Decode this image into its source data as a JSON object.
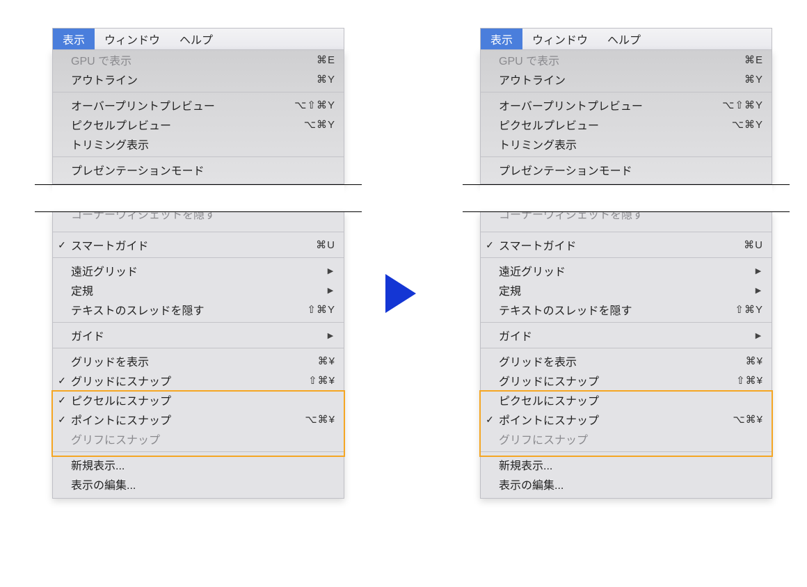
{
  "menubar": {
    "view": "表示",
    "window": "ウィンドウ",
    "help": "ヘルプ"
  },
  "top_group": {
    "gpu_preview": "GPU で表示",
    "gpu_preview_sc": "⌘E",
    "outline": "アウトライン",
    "outline_sc": "⌘Y",
    "overprint": "オーバープリントプレビュー",
    "overprint_sc": "⌥⇧⌘Y",
    "pixel_preview": "ピクセルプレビュー",
    "pixel_preview_sc": "⌥⌘Y",
    "trim_view": "トリミング表示",
    "presentation": "プレゼンテーションモード"
  },
  "cut": {
    "corner_widget": "コーナーウィジェットを隠す"
  },
  "mid_group": {
    "smart_guides": "スマートガイド",
    "smart_guides_sc": "⌘U",
    "perspective_grid": "遠近グリッド",
    "rulers": "定規",
    "hide_text_threads": "テキストのスレッドを隠す",
    "hide_text_threads_sc": "⇧⌘Y",
    "guides": "ガイド"
  },
  "snap_group": {
    "show_grid": "グリッドを表示",
    "show_grid_sc": "⌘¥",
    "snap_to_grid": "グリッドにスナップ",
    "snap_to_grid_sc": "⇧⌘¥",
    "snap_to_pixel": "ピクセルにスナップ",
    "snap_to_point": "ポイントにスナップ",
    "snap_to_point_sc": "⌥⌘¥",
    "snap_to_glyph": "グリフにスナップ"
  },
  "bottom_group": {
    "new_view": "新規表示...",
    "edit_views": "表示の編集..."
  },
  "state": {
    "left": {
      "snap_to_grid": true,
      "snap_to_pixel": true,
      "snap_to_point": true
    },
    "right": {
      "snap_to_grid": false,
      "snap_to_pixel": false,
      "snap_to_point": true
    }
  },
  "glyph": {
    "check": "✓",
    "arrow": "▶"
  }
}
